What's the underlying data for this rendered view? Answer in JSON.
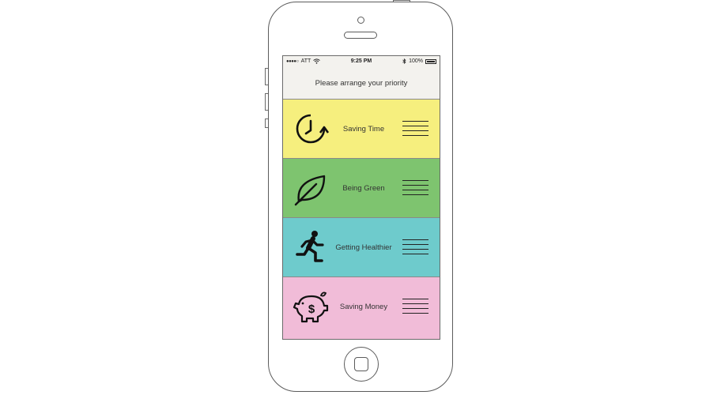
{
  "status_bar": {
    "signal_dots": "●●●●○",
    "carrier": "ATT",
    "wifi_icon": "wifi-icon",
    "time": "9:25 PM",
    "bluetooth_icon": "bluetooth-icon",
    "battery_percent": "100%"
  },
  "header": {
    "title": "Please arrange your priority"
  },
  "priorities": [
    {
      "label": "Saving Time",
      "color": "#f6ef7e",
      "icon": "clock-refresh-icon"
    },
    {
      "label": "Being Green",
      "color": "#7ec46f",
      "icon": "leaf-icon"
    },
    {
      "label": "Getting Healthier",
      "color": "#6ecbcc",
      "icon": "running-person-icon"
    },
    {
      "label": "Saving Money",
      "color": "#f1bcd8",
      "icon": "piggy-bank-icon"
    }
  ]
}
